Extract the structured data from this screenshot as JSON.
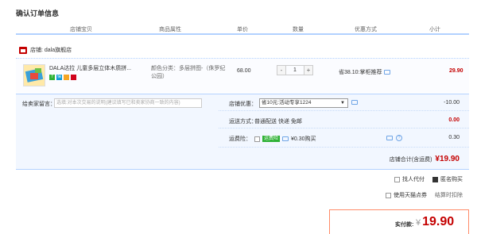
{
  "page": {
    "title": "确认订单信息"
  },
  "columns": [
    "店铺宝贝",
    "商品属性",
    "单价",
    "数量",
    "优惠方式",
    "小计"
  ],
  "shop": {
    "label": "店铺: dala旗舰店"
  },
  "item": {
    "title": "DALA达拉 儿童多层立体木质拼...",
    "badges": [
      "7",
      "保"
    ],
    "attributes": "颜色分类：多层拼图-（侏罗纪公园）",
    "price": "68.00",
    "quantity": "1",
    "minus": "-",
    "plus": "+",
    "promotion": "省38.10:掌柜推荐",
    "subtotal": "29.90"
  },
  "detail": {
    "message_label": "给卖家留言：",
    "message_placeholder": "选填:对本次交易的说明(建议填写已和卖家协商一致的内容)",
    "shop_discount_label": "店铺优惠：",
    "shop_discount_selected": "省10元:活动专享1224",
    "shop_discount_value": "-10.00",
    "shipping_label": "运送方式：",
    "shipping_option": "普通配送 快递 免邮",
    "shipping_value": "0.00",
    "insurance_label": "运费险：",
    "insurance_tag": "运费险",
    "insurance_text": "¥0.30购买",
    "insurance_value": "0.30",
    "shop_total_label": "店铺合计(含运费)",
    "shop_total_value": "¥19.90"
  },
  "options": {
    "proxy_pay": "找人代付",
    "anonymous": "匿名购买",
    "coupon": "使用天猫点券",
    "coupon_note": "结算时扣除"
  },
  "final": {
    "label": "实付款:",
    "currency": "¥",
    "amount": "19.90"
  },
  "colors": {
    "accent_red": "#c40000",
    "header_border": "#b2d1ff",
    "detail_bg": "#f2f7ff"
  }
}
